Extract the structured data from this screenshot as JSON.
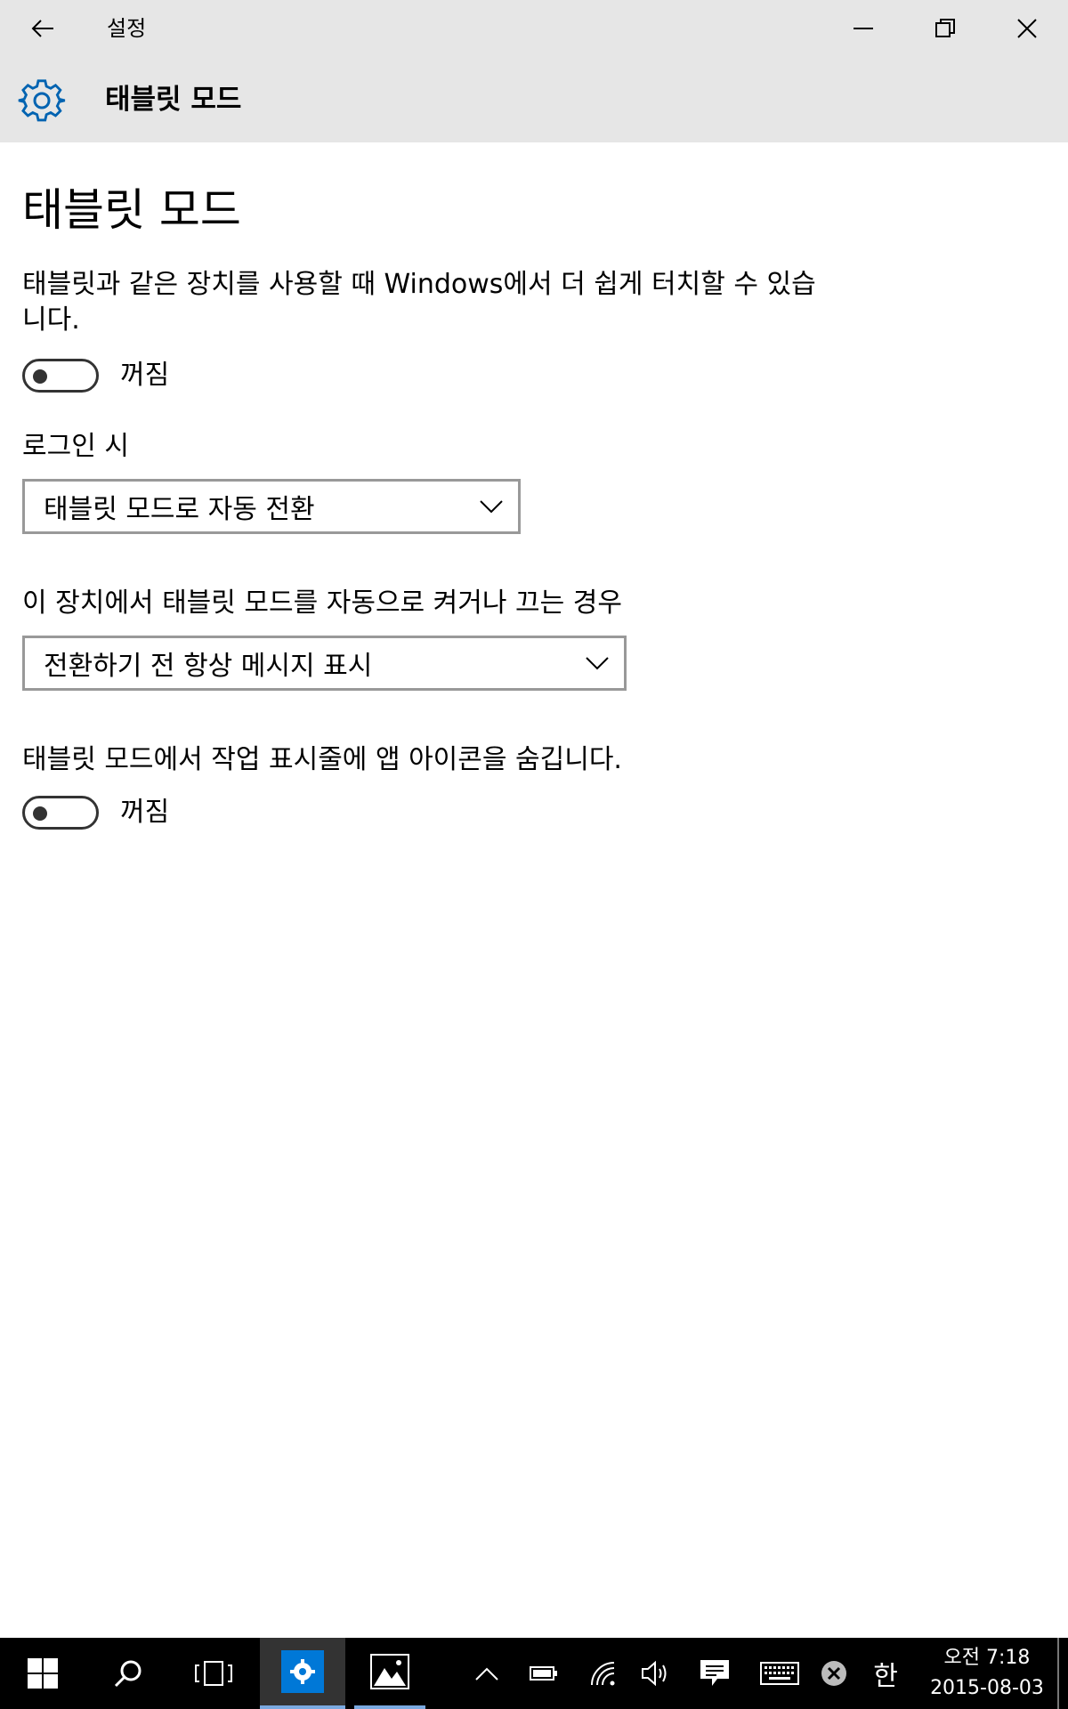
{
  "window": {
    "title": "설정"
  },
  "header": {
    "title": "태블릿 모드",
    "accent": "#0063b1"
  },
  "content": {
    "page_title": "태블릿 모드",
    "description": "태블릿과 같은 장치를 사용할 때 Windows에서 더 쉽게 터치할 수 있습니다.",
    "toggle1": {
      "state_label": "꺼짐",
      "on": false
    },
    "signin_label": "로그인 시",
    "signin_select": {
      "selected": "태블릿 모드로 자동 전환"
    },
    "auto_switch_label": "이 장치에서 태블릿 모드를 자동으로 켜거나 끄는 경우",
    "auto_switch_select": {
      "selected": "전환하기 전 항상 메시지 표시"
    },
    "hide_icons_label": "태블릿 모드에서 작업 표시줄에 앱 아이콘을 숨깁니다.",
    "toggle2": {
      "state_label": "꺼짐",
      "on": false
    }
  },
  "taskbar": {
    "clock_time": "오전 7:18",
    "clock_date": "2015-08-03",
    "ime_label": "한",
    "icons": [
      "start-icon",
      "search-icon",
      "task-view-icon",
      "settings-icon",
      "photos-icon",
      "show-hidden-icon",
      "battery-icon",
      "network-icon",
      "volume-icon",
      "action-center-icon",
      "keyboard-icon",
      "close-circle-icon",
      "ime-icon"
    ]
  }
}
